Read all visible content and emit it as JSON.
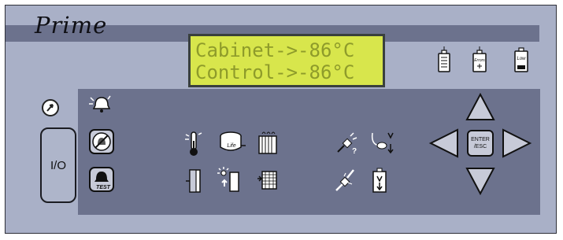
{
  "brand": {
    "name": "Prime"
  },
  "display": {
    "line1": "Cabinet->-86°C",
    "line2": "Control->-86°C"
  },
  "status_icons": [
    {
      "name": "battery-icon",
      "text": ""
    },
    {
      "name": "battery-error-icon",
      "text": "Errors"
    },
    {
      "name": "battery-low-icon",
      "text": "Low"
    }
  ],
  "controls": {
    "power_label": "I/O",
    "test_label": "TEST",
    "life_label": "Life",
    "enter_label_1": "ENTER",
    "enter_label_2": "/ESC"
  },
  "colors": {
    "panel": "#a9b0c7",
    "band": "#6c728d",
    "lcd": "#d8e64c",
    "lcd_text": "#8e9b2a"
  }
}
